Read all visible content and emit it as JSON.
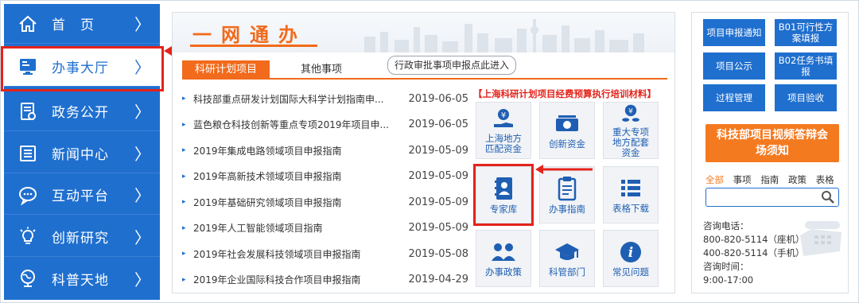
{
  "nav": {
    "items": [
      {
        "label": "首　页",
        "icon": "home-icon"
      },
      {
        "label": "办事大厅",
        "icon": "monitor-icon"
      },
      {
        "label": "政务公开",
        "icon": "document-icon"
      },
      {
        "label": "新闻中心",
        "icon": "news-icon"
      },
      {
        "label": "互动平台",
        "icon": "chat-icon"
      },
      {
        "label": "创新研究",
        "icon": "bulb-icon"
      },
      {
        "label": "科普天地",
        "icon": "globe-icon"
      }
    ],
    "chevron": "〉"
  },
  "banner": {
    "title": "一网通办"
  },
  "tabs": {
    "primary": "科研计划项目",
    "secondary": "其他事项",
    "approval_link": "行政审批事项申报点此进入"
  },
  "notice": "【上海科研计划项目经费预算执行培训材料】",
  "list": [
    {
      "title": "科技部重点研发计划国际大科学计划指南申...",
      "date": "2019-06-05"
    },
    {
      "title": "蓝色粮仓科技创新等重点专项2019年项目申...",
      "date": "2019-06-05"
    },
    {
      "title": "2019年集成电路领域项目申报指南",
      "date": "2019-05-09"
    },
    {
      "title": "2019年高新技术领域项目申报指南",
      "date": "2019-05-09"
    },
    {
      "title": "2019年基础研究领域项目申报指南",
      "date": "2019-05-09"
    },
    {
      "title": "2019年人工智能领域项目指南",
      "date": "2019-05-09"
    },
    {
      "title": "2019年社会发展科技领域项目申报指南",
      "date": "2019-05-08"
    },
    {
      "title": "2019年企业国际科技合作项目申报指南",
      "date": "2019-04-29"
    }
  ],
  "services": [
    {
      "label": "上海地方匹配资金",
      "icon": "money-hand-icon"
    },
    {
      "label": "创新资金",
      "icon": "cash-icon"
    },
    {
      "label": "重大专项地方配套资金",
      "icon": "coins-icon"
    },
    {
      "label": "专家库",
      "icon": "contact-book-icon"
    },
    {
      "label": "办事指南",
      "icon": "clipboard-icon"
    },
    {
      "label": "表格下载",
      "icon": "list-icon"
    },
    {
      "label": "办事政策",
      "icon": "people-icon"
    },
    {
      "label": "科管部门",
      "icon": "graduation-cap-icon"
    },
    {
      "label": "常见问题",
      "icon": "info-icon"
    }
  ],
  "right": {
    "buttons": [
      "项目申报通知",
      "B01可行性方案填报",
      "项目公示",
      "B02任务书填报",
      "过程管理",
      "项目验收"
    ],
    "video_button": "科技部项目视频答辩会场须知",
    "search_tabs": [
      "全部",
      "事项",
      "指南",
      "政策",
      "表格"
    ],
    "search_placeholder": "",
    "contact": {
      "phone_label": "咨询电话：",
      "phone1": "800-820-5114（座机）",
      "phone2": "400-820-5114（手机）",
      "hours_label": "咨询时间：",
      "hours": "9:00-17:00"
    }
  },
  "colors": {
    "nav_blue": "#1f6fcf",
    "accent_orange": "#f26a1b",
    "highlight_red": "#e4231b"
  }
}
